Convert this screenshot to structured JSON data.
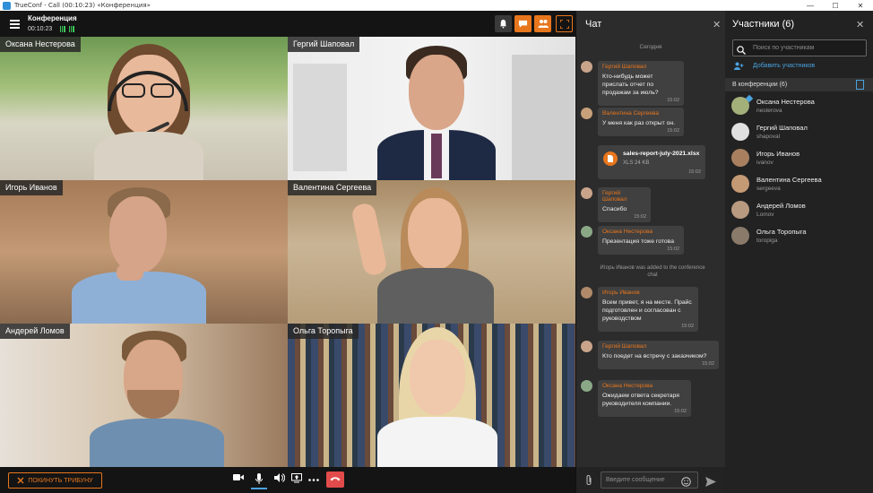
{
  "window": {
    "title": "TrueConf - Call (00:10:23) «Конференция»",
    "minimize": "—",
    "maximize": "☐",
    "close": "✕"
  },
  "header": {
    "title": "Конференция",
    "timer": "00:10:23"
  },
  "tiles": [
    {
      "name": "Оксана Нестерова"
    },
    {
      "name": "Гергий Шаповал"
    },
    {
      "name": "Игорь Иванов"
    },
    {
      "name": "Валентина Сергеева"
    },
    {
      "name": "Андерей Ломов"
    },
    {
      "name": "Ольга Торопыга"
    }
  ],
  "bottombar": {
    "leave_label": "ПОКИНУТЬ ТРИБУНУ"
  },
  "chat": {
    "title": "Чат",
    "day": "Сегодня",
    "messages": [
      {
        "author": "Гергий Шаповал",
        "text": "Кто-нибудь может прислать отчет по продажам за июль?",
        "time": "15:02"
      },
      {
        "author": "Валентина Сергеева",
        "text": "У меня как раз открыт он.",
        "time": "15:02"
      },
      {
        "file_name": "sales-report-july-2021.xlsx",
        "file_meta": "XLS 24 KB",
        "time": "15:02"
      },
      {
        "author": "Гергий Шаповал",
        "text": "Спасибо",
        "time": "15:02"
      },
      {
        "author": "Оксана Нестерова",
        "text": "Презентация тоже готова",
        "time": "15:02"
      },
      {
        "system": "Игорь Иванов was added to the conference chat"
      },
      {
        "author": "Игорь Иванов",
        "text": "Всем привет, я на месте. Прайс подготовлен и согласован с руководством",
        "time": "15:02"
      },
      {
        "author": "Гергий Шаповал",
        "text": "Кто поедет на встречу с заказчиком?",
        "time": "15:02"
      },
      {
        "author": "Оксана Нестерова",
        "text": "Ожидаем ответа секретаря руководителя компании.",
        "time": "15:02"
      }
    ],
    "input_placeholder": "Введите сообщение"
  },
  "participants": {
    "title": "Участники (6)",
    "search_placeholder": "Поиск по участникам",
    "add_label": "Добавить участников",
    "section_label": "В конференции (6)",
    "items": [
      {
        "name": "Оксана Нестерова",
        "login": "nesterova"
      },
      {
        "name": "Гергий Шаповал",
        "login": "shapoval"
      },
      {
        "name": "Игорь Иванов",
        "login": "ivanov"
      },
      {
        "name": "Валентина Сергеева",
        "login": "sergeeva"
      },
      {
        "name": "Андерей Ломов",
        "login": "Lomov"
      },
      {
        "name": "Ольга Торопыга",
        "login": "toropiga"
      }
    ]
  },
  "colors": {
    "accent": "#e8761d",
    "active_speaker": "#38c77e",
    "link": "#4aa3e0",
    "hangup": "#e24b4b"
  },
  "icons": [
    "hamburger-icon",
    "bell-icon",
    "chat-icon",
    "participants-icon",
    "fullscreen-icon",
    "camera-icon",
    "microphone-icon",
    "speaker-icon",
    "screen-share-icon",
    "more-icon",
    "hangup-icon",
    "attach-icon",
    "emoji-icon",
    "send-icon",
    "search-icon",
    "add-user-icon",
    "close-icon",
    "file-icon"
  ]
}
